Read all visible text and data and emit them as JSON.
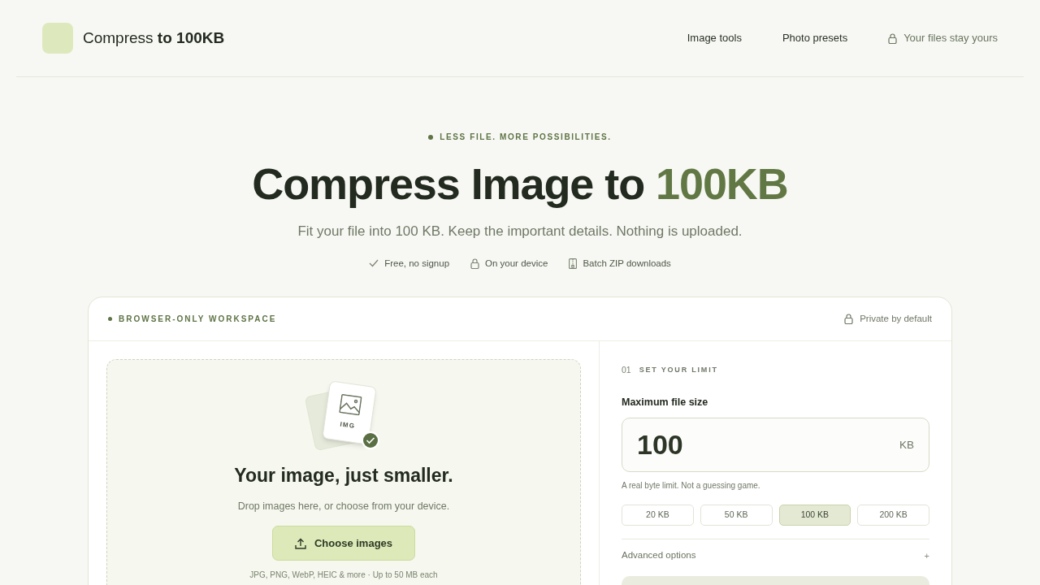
{
  "header": {
    "logo_text": "Compress",
    "logo_bold": "to 100KB",
    "nav": [
      {
        "label": "Image tools",
        "kind": "link"
      },
      {
        "label": "Photo presets",
        "kind": "link"
      },
      {
        "label": "Your files stay yours",
        "kind": "note"
      }
    ]
  },
  "hero": {
    "eyebrow": "LESS FILE. MORE POSSIBILITIES.",
    "title_lead": "Compress Image to",
    "title_accent": "100KB",
    "subtitle": "Fit your file into 100 KB. Keep the important details. Nothing is uploaded.",
    "features": [
      {
        "label": "Free, no signup",
        "kind": "check"
      },
      {
        "label": "On your device",
        "kind": "lock"
      },
      {
        "label": "Batch ZIP downloads",
        "kind": "zip"
      }
    ]
  },
  "workspace": {
    "label": "BROWSER-ONLY WORKSPACE",
    "privacy": "Private by default",
    "dropzone": {
      "card_label": "IMG",
      "title": "Your image, just smaller.",
      "hint": "Drop images here, or choose from your device.",
      "button": "Choose images",
      "formats": "JPG, PNG, WebP, HEIC & more · Up to 50 MB each"
    },
    "settings": {
      "step_number": "01",
      "step_title": "SET YOUR LIMIT",
      "field_label": "Maximum file size",
      "value": "100",
      "unit": "KB",
      "help": "A real byte limit. Not a guessing game.",
      "presets": [
        {
          "label": "20 KB",
          "selected": false
        },
        {
          "label": "50 KB",
          "selected": false
        },
        {
          "label": "100 KB",
          "selected": true
        },
        {
          "label": "200 KB",
          "selected": false
        }
      ],
      "advanced": {
        "label": "Advanced options",
        "toggle": "+"
      }
    }
  }
}
